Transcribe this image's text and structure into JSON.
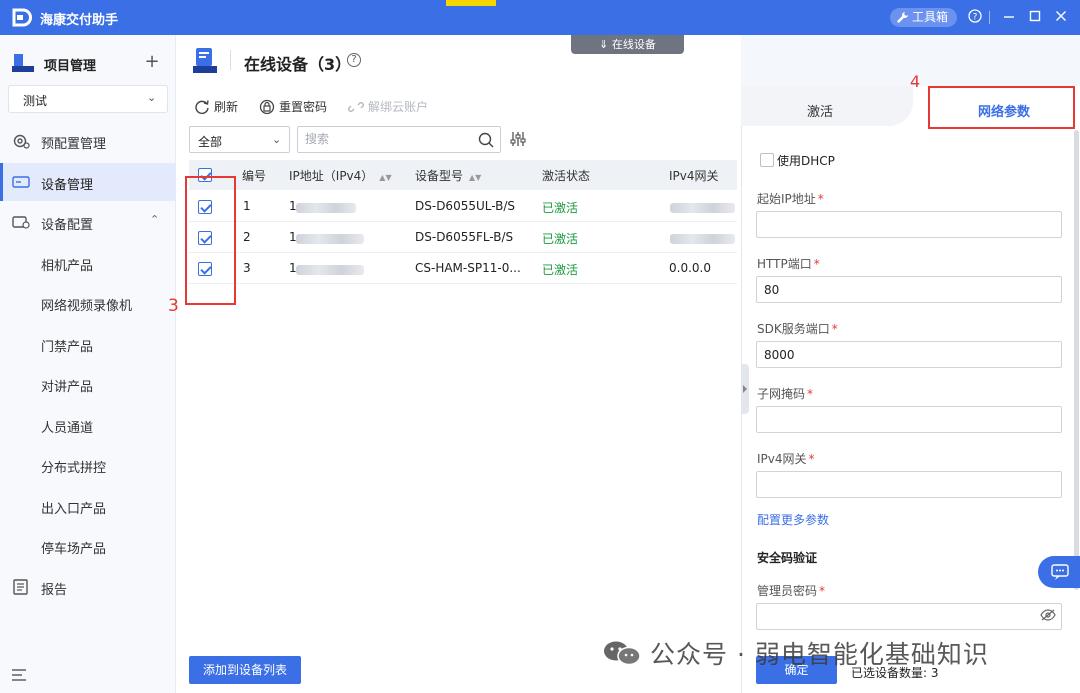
{
  "app": {
    "title": "海康交付助手",
    "toolbox_label": "工具箱"
  },
  "sidebar": {
    "project_label": "项目管理",
    "project_selected": "测试",
    "nav": [
      {
        "label": "预配置管理",
        "icon": "config-gear-icon"
      },
      {
        "label": "设备管理",
        "icon": "device-icon",
        "active": true
      },
      {
        "label": "设备配置",
        "icon": "device-config-icon",
        "expanded": true
      }
    ],
    "sub_items": [
      "相机产品",
      "网络视频录像机",
      "门禁产品",
      "对讲产品",
      "人员通道",
      "分布式拼控",
      "出入口产品",
      "停车场产品"
    ],
    "report_label": "报告"
  },
  "main": {
    "title": "在线设备（3）",
    "collapse_label": "在线设备",
    "toolbar": {
      "refresh": "刷新",
      "reset_password": "重置密码",
      "unbind_cloud": "解绑云账户"
    },
    "filter_selected": "全部",
    "search_placeholder": "搜索",
    "table": {
      "headers": [
        "编号",
        "IP地址（IPv4）",
        "设备型号",
        "激活状态",
        "IPv4网关"
      ],
      "rows": [
        {
          "no": "1",
          "ip": "1",
          "model": "DS-D6055UL-B/S",
          "status": "已激活",
          "gateway": ""
        },
        {
          "no": "2",
          "ip": "1",
          "model": "DS-D6055FL-B/S",
          "status": "已激活",
          "gateway": ""
        },
        {
          "no": "3",
          "ip": "1",
          "model": "CS-HAM-SP11-0...",
          "status": "已激活",
          "gateway": "0.0.0.0"
        }
      ]
    },
    "annotation_3": "3",
    "add_button": "添加到设备列表"
  },
  "panel": {
    "tabs": [
      "激活",
      "网络参数"
    ],
    "active_tab": 1,
    "annotation_4": "4",
    "dhcp_label": "使用DHCP",
    "fields": [
      {
        "label": "起始IP地址",
        "value": ""
      },
      {
        "label": "HTTP端口",
        "value": "80"
      },
      {
        "label": "SDK服务端口",
        "value": "8000"
      },
      {
        "label": "子网掩码",
        "value": ""
      },
      {
        "label": "IPv4网关",
        "value": ""
      }
    ],
    "more_link": "配置更多参数",
    "security_title": "安全码验证",
    "admin_password_label": "管理员密码",
    "confirm_button": "确定",
    "selected_count_label": "已选设备数量:",
    "selected_count": "3"
  },
  "watermark": "公众号 · 弱电智能化基础知识",
  "colors": {
    "primary": "#3a6fe6",
    "annotation": "#e53935",
    "active_status": "#1b9a3c"
  }
}
